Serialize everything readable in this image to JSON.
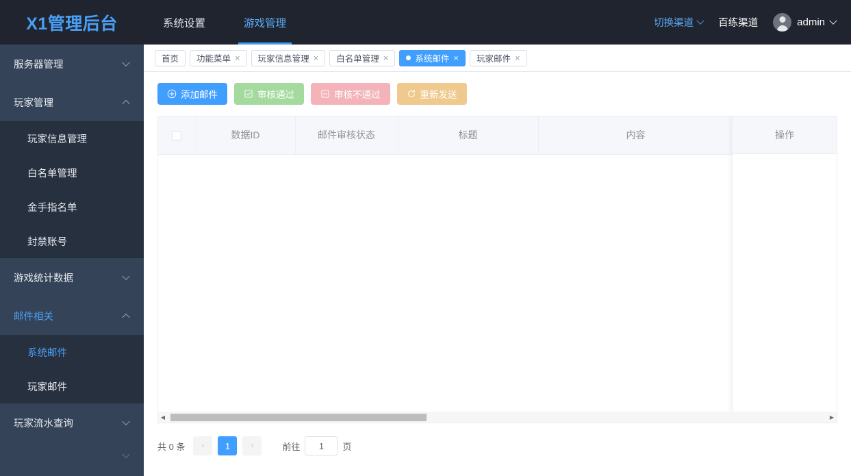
{
  "header": {
    "brand": "X1管理后台",
    "nav": [
      {
        "label": "系统设置",
        "active": false
      },
      {
        "label": "游戏管理",
        "active": true
      }
    ],
    "switch_channel": "切换渠道",
    "current_channel": "百练渠道",
    "user_name": "admin"
  },
  "sidebar": {
    "groups": [
      {
        "label": "服务器管理",
        "open": false,
        "items": []
      },
      {
        "label": "玩家管理",
        "open": true,
        "items": [
          {
            "label": "玩家信息管理",
            "active": false
          },
          {
            "label": "白名单管理",
            "active": false
          },
          {
            "label": "金手指名单",
            "active": false
          },
          {
            "label": "封禁账号",
            "active": false
          }
        ]
      },
      {
        "label": "游戏统计数据",
        "open": false,
        "items": []
      },
      {
        "label": "邮件相关",
        "open": true,
        "items": [
          {
            "label": "系统邮件",
            "active": true
          },
          {
            "label": "玩家邮件",
            "active": false
          }
        ]
      },
      {
        "label": "玩家流水查询",
        "open": false,
        "items": []
      }
    ]
  },
  "tabs": [
    {
      "label": "首页",
      "active": false,
      "closable": false
    },
    {
      "label": "功能菜单",
      "active": false,
      "closable": true
    },
    {
      "label": "玩家信息管理",
      "active": false,
      "closable": true
    },
    {
      "label": "白名单管理",
      "active": false,
      "closable": true
    },
    {
      "label": "系统邮件",
      "active": true,
      "closable": true
    },
    {
      "label": "玩家邮件",
      "active": false,
      "closable": true
    }
  ],
  "toolbar": {
    "add_label": "添加邮件",
    "approve_label": "审核通过",
    "reject_label": "审核不通过",
    "resend_label": "重新发送"
  },
  "table": {
    "columns": [
      "数据ID",
      "邮件审核状态",
      "标题",
      "内容",
      "操作"
    ],
    "rows": []
  },
  "pagination": {
    "total_text": "共 0 条",
    "prev": "‹",
    "next": "›",
    "pages": [
      "1"
    ],
    "current_page": "1",
    "jump_prefix": "前往",
    "jump_value": "1",
    "jump_suffix": "页"
  },
  "colors": {
    "brand_blue": "#4a9ff5",
    "primary": "#409eff",
    "header_bg": "#20242e",
    "sidebar_bg": "#344357",
    "submenu_bg": "#26303f",
    "success": "#a4da9e",
    "danger": "#f3b3b9",
    "warning": "#efc98d"
  }
}
